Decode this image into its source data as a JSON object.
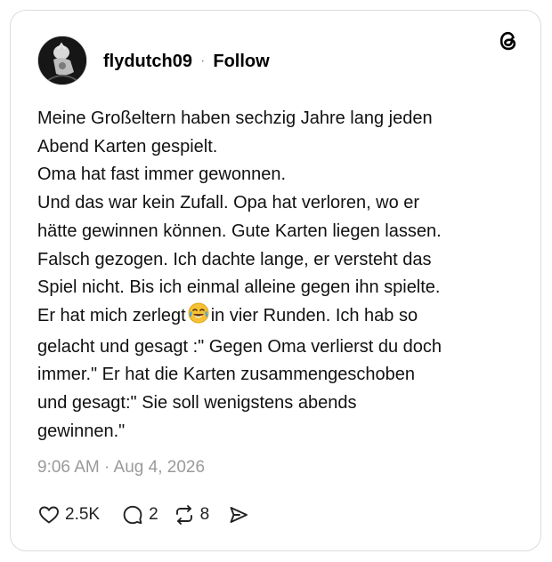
{
  "post": {
    "author": {
      "username": "flydutch09",
      "avatar_icon": "avatar-image"
    },
    "follow_label": "Follow",
    "separator": "·",
    "logo_icon": "threads-logo-icon",
    "text_lines": [
      "Meine Großeltern haben sechzig Jahre lang jeden",
      "Abend Karten gespielt.",
      "Oma hat fast immer gewonnen.",
      "Und das war kein Zufall. Opa hat verloren, wo er",
      "hätte gewinnen können. Gute Karten liegen lassen.",
      "Falsch gezogen. Ich dachte lange, er versteht das",
      "Spiel nicht. Bis ich einmal alleine gegen ihn spielte.",
      "in vier Runden. Ich hab so",
      "gelacht und gesagt :\" Gegen Oma verlierst du doch",
      "immer.\" Er hat die Karten zusammengeschoben",
      "und gesagt:\" Sie soll wenigstens abends",
      "gewinnen.\""
    ],
    "line8_prefix": "Er hat mich zerlegt",
    "emoji_icon": "tears-of-joy-emoji",
    "timestamp": "9:06 AM · Aug 4, 2026",
    "stats": {
      "likes": "2.5K",
      "replies": "2",
      "reposts": "8"
    },
    "icons": {
      "like": "heart-icon",
      "reply": "comment-icon",
      "repost": "repost-icon",
      "share": "share-icon"
    }
  }
}
